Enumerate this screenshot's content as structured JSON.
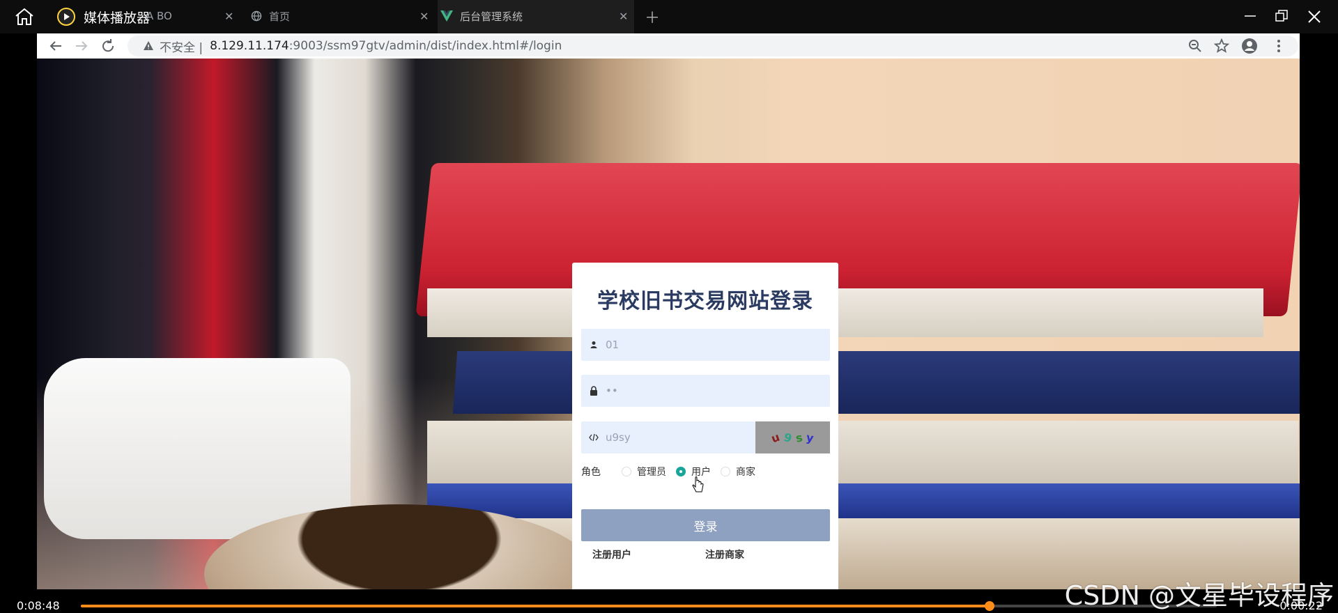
{
  "player": {
    "title": "媒体播放器",
    "time_elapsed": "0:08:48",
    "time_remaining": "0:00:22",
    "progress": 0.8,
    "watermark": "CSDN @文星毕设程序"
  },
  "browser": {
    "tabs": [
      {
        "label": "A BO"
      },
      {
        "label": "首页"
      },
      {
        "label": "后台管理系统",
        "active": true
      }
    ],
    "insecure_label": "不安全",
    "url_host": "8.129.11.174",
    "url_rest": ":9003/ssm97gtv/admin/dist/index.html#/login"
  },
  "login": {
    "title": "学校旧书交易网站登录",
    "username_value": "01",
    "password_value": "••",
    "code_value": "u9sy",
    "captcha_chars": [
      "u",
      "9",
      "s",
      "y"
    ],
    "captcha_colors": [
      "#8b1a1a",
      "#2aa58a",
      "#2e8b2e",
      "#3333cc"
    ],
    "role_label": "角色",
    "roles": [
      {
        "label": "管理员",
        "checked": false
      },
      {
        "label": "用户",
        "checked": true
      },
      {
        "label": "商家",
        "checked": false
      }
    ],
    "login_button": "登录",
    "register_user": "注册用户",
    "register_merchant": "注册商家"
  },
  "colors": {
    "accent": "#1aa59a",
    "login_button_bg": "#8ea1c0",
    "input_bg": "#e8f0fe",
    "progress": "#ff8c1a"
  }
}
